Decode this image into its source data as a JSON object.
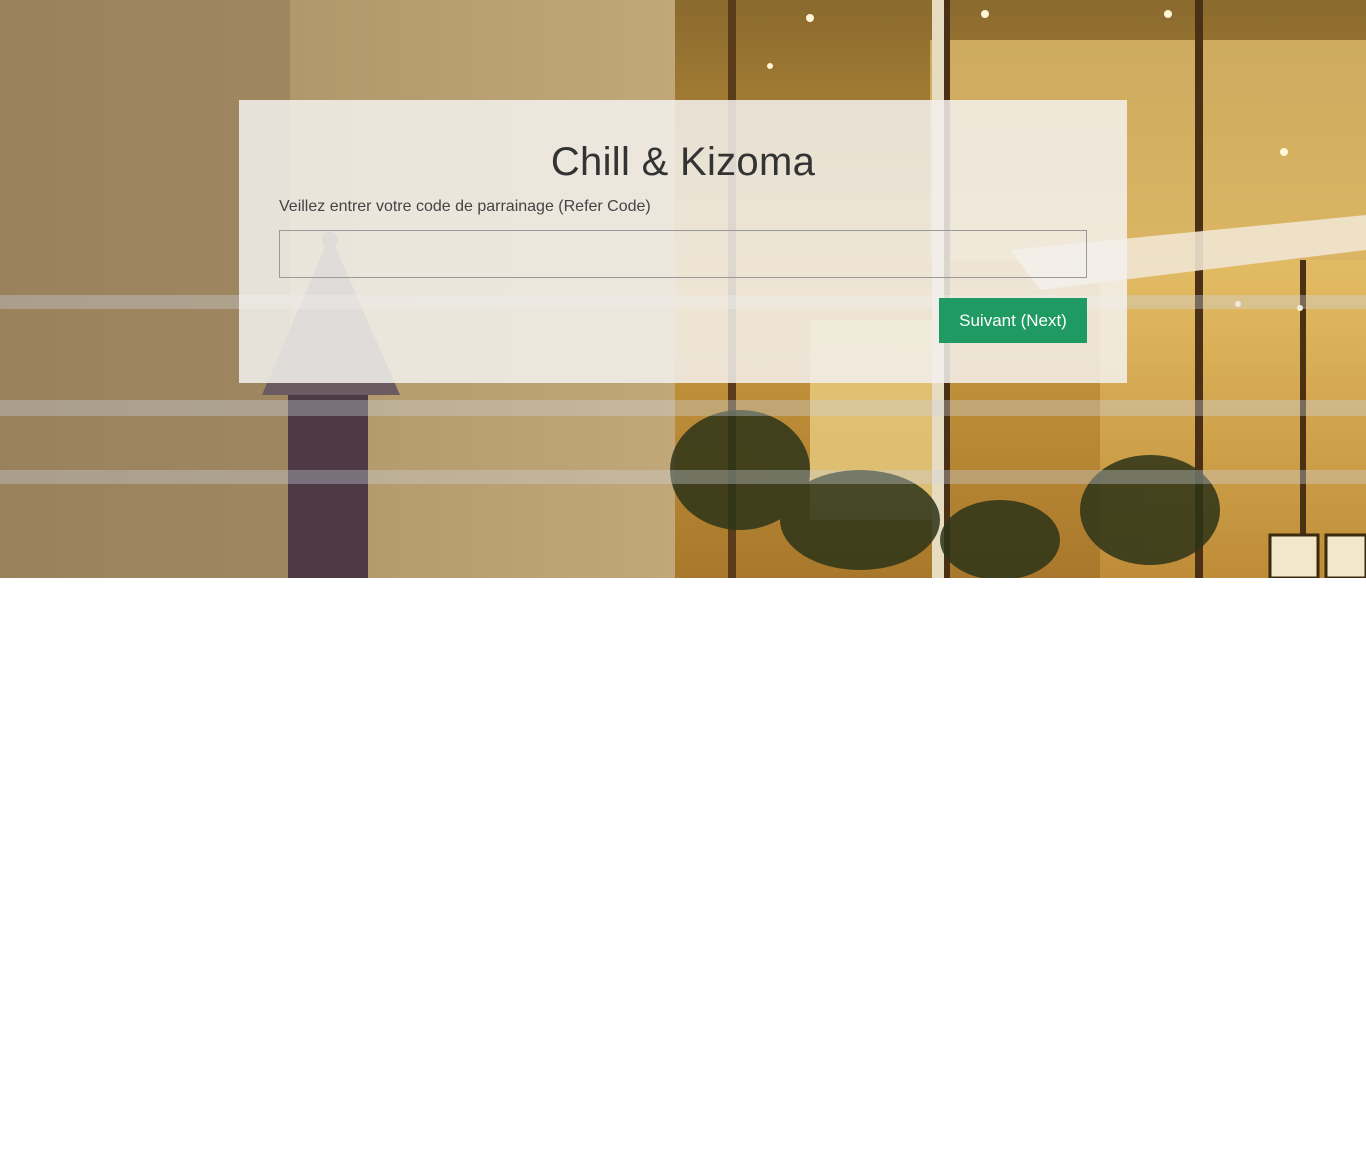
{
  "hero": {
    "background_image": "house-exterior-photo",
    "accent_color": "#1f9a63"
  },
  "form": {
    "title": "Chill & Kizoma",
    "label": "Veillez entrer votre code de parrainage (Refer Code)",
    "input_value": "",
    "input_placeholder": "",
    "next_label": "Suivant (Next)"
  }
}
